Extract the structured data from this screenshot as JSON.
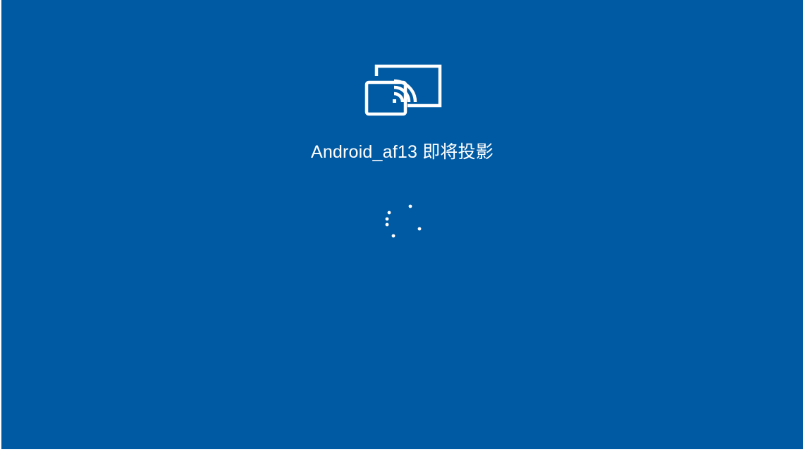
{
  "screen": {
    "background_color": "#005aa3",
    "foreground_color": "#ffffff",
    "icon": "wireless-display-cast-icon",
    "device_name": "Android_af13",
    "message_suffix": "即将投影",
    "message": "Android_af13 即将投影",
    "spinner": "loading-dots-spinner"
  }
}
